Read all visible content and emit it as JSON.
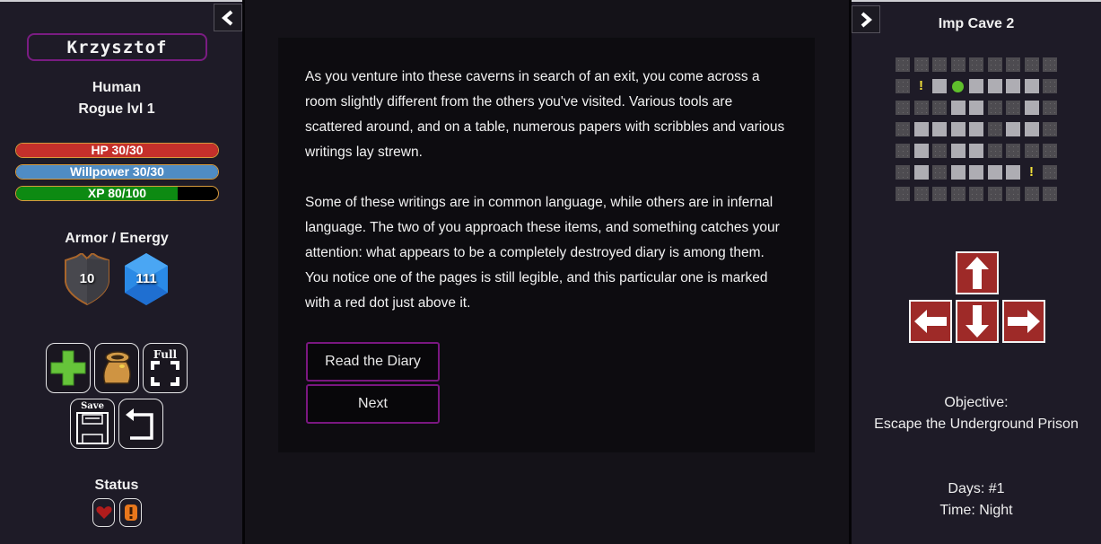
{
  "character": {
    "name": "Krzysztof",
    "race": "Human",
    "class_level": "Rogue lvl 1",
    "bars": [
      {
        "id": "hp",
        "label": "HP 30/30",
        "current": 30,
        "max": 30,
        "color": "#c5302b"
      },
      {
        "id": "willpower",
        "label": "Willpower 30/30",
        "current": 30,
        "max": 30,
        "color": "#4f8cc4"
      },
      {
        "id": "xp",
        "label": "XP 80/100",
        "current": 80,
        "max": 100,
        "color": "#0d8a12"
      }
    ],
    "armor_energy_title": "Armor / Energy",
    "armor": "10",
    "energy": "111",
    "status_title": "Status"
  },
  "actions": {
    "heal": "heal",
    "inventory": "inventory",
    "fullscreen_label": "Full",
    "save_label": "Save",
    "back": "back"
  },
  "story": {
    "paragraphs": [
      "As you venture into these caverns in search of an exit, you come across a room slightly different from the others you've visited. Various tools are scattered around, and on a table, numerous papers with scribbles and various writings lay strewn.",
      "Some of these writings are in common language, while others are in infernal language. The two of you approach these items, and something catches your attention: what appears to be a completely destroyed diary is among them. You notice one of the pages is still legible, and this particular one is marked with a red dot just above it."
    ],
    "choices": [
      "Read the Diary",
      "Next"
    ]
  },
  "map": {
    "title": "Imp Cave 2",
    "legend": {
      "W": "wall",
      "F": "floor",
      "P": "player",
      "M": "event-marker"
    },
    "rows": [
      [
        "W",
        "W",
        "W",
        "W",
        "W",
        "W",
        "W",
        "W",
        "W"
      ],
      [
        "W",
        "M",
        "F",
        "P",
        "F",
        "F",
        "F",
        "F",
        "W"
      ],
      [
        "W",
        "W",
        "W",
        "F",
        "F",
        "W",
        "W",
        "F",
        "W"
      ],
      [
        "W",
        "F",
        "F",
        "F",
        "F",
        "W",
        "F",
        "F",
        "W"
      ],
      [
        "W",
        "F",
        "W",
        "F",
        "F",
        "W",
        "W",
        "W",
        "W"
      ],
      [
        "W",
        "F",
        "W",
        "F",
        "F",
        "F",
        "F",
        "M",
        "W"
      ],
      [
        "W",
        "W",
        "W",
        "W",
        "W",
        "W",
        "W",
        "W",
        "W"
      ]
    ],
    "marker_glyph": "!",
    "colors": {
      "player": "#5fbf2c",
      "marker": "#f4e23a",
      "arrow_bg": "#9e2a28"
    }
  },
  "navigation": {
    "up": "up-arrow",
    "down": "down-arrow",
    "left": "left-arrow",
    "right": "right-arrow"
  },
  "info": {
    "objective_label": "Objective:",
    "objective": "Escape the Underground Prison",
    "days": "Days: #1",
    "time": "Time: Night"
  }
}
